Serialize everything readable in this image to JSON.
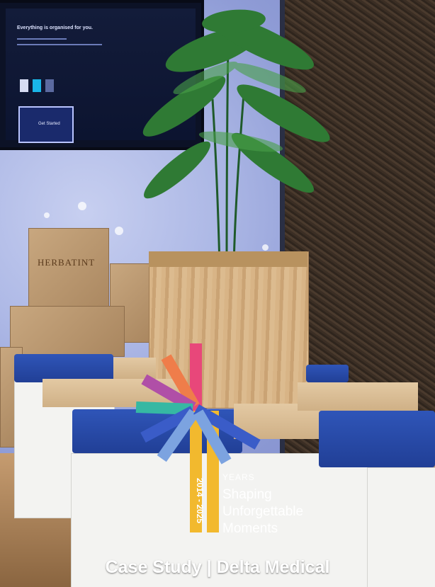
{
  "overlay": {
    "caption": "Case Study | Delta Medical",
    "logo": {
      "years_label": "YEARS",
      "date_range": "2014 - 2025",
      "tagline_lines": [
        "Shaping",
        "Unforgettable",
        "Moments"
      ]
    }
  },
  "scene": {
    "tv_screen": {
      "title": "Everything is organised for you.",
      "button_label": "Get Started"
    },
    "box_label": "HERBATINT"
  },
  "colors": {
    "cushion": "#2a4aa6",
    "logo_gold": "#f2b92e",
    "logo_pink": "#e8477a",
    "logo_orange": "#ef7d4a",
    "logo_purple": "#b04fa7",
    "logo_teal": "#36b8a3",
    "logo_blue": "#3a5cc8",
    "logo_lightblue": "#7ca3e0"
  }
}
